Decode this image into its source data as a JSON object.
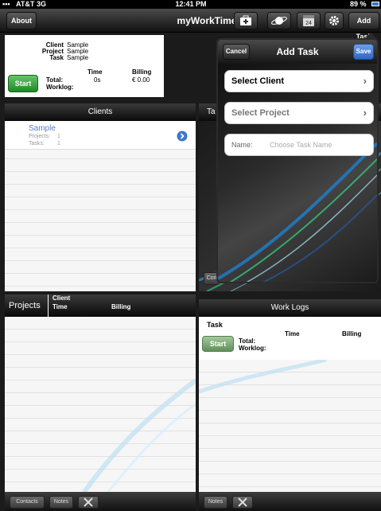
{
  "status": {
    "carrier": "AT&T",
    "network": "3G",
    "time": "12:41 PM",
    "battery": "89 %"
  },
  "nav": {
    "about": "About",
    "title": "myWorkTime",
    "add_task": "Add Task",
    "calendar_day": "24"
  },
  "current": {
    "client_label": "Client",
    "client_value": "Sample",
    "project_label": "Project",
    "project_value": "Sample",
    "task_label": "Task",
    "task_value": "Sample",
    "time_header": "Time",
    "billing_header": "Billing",
    "total_label": "Total:",
    "total_time": "0s",
    "total_billing": "€ 0.00",
    "worklog_label": "Worklog:",
    "start": "Start"
  },
  "clients": {
    "header": "Clients",
    "items": [
      {
        "name": "Sample",
        "projects_label": "Projects:",
        "projects": "1",
        "tasks_label": "Tasks:",
        "tasks": "1"
      }
    ]
  },
  "tasks_header_partial": "Ta",
  "projects": {
    "title": "Projects",
    "client": "Client",
    "time": "Time",
    "billing": "Billing"
  },
  "worklogs": {
    "header": "Work Logs",
    "task": "Task",
    "time": "Time",
    "billing": "Billing",
    "total": "Total:",
    "worklog": "Worklog:",
    "start": "Start"
  },
  "toolbar_left": {
    "contacts": "Contacts",
    "notes": "Notes"
  },
  "toolbar_right": {
    "notes": "Notes"
  },
  "partial_button": "Con",
  "add_task_popover": {
    "cancel": "Cancel",
    "title": "Add Task",
    "save": "Save",
    "select_client": "Select Client",
    "select_project": "Select Project",
    "name_label": "Name:",
    "name_placeholder": "Choose Task Name"
  },
  "colors": {
    "accent_blue": "#3b78c8",
    "start_green": "#2e9a33",
    "client_link": "#5a7fc0"
  }
}
